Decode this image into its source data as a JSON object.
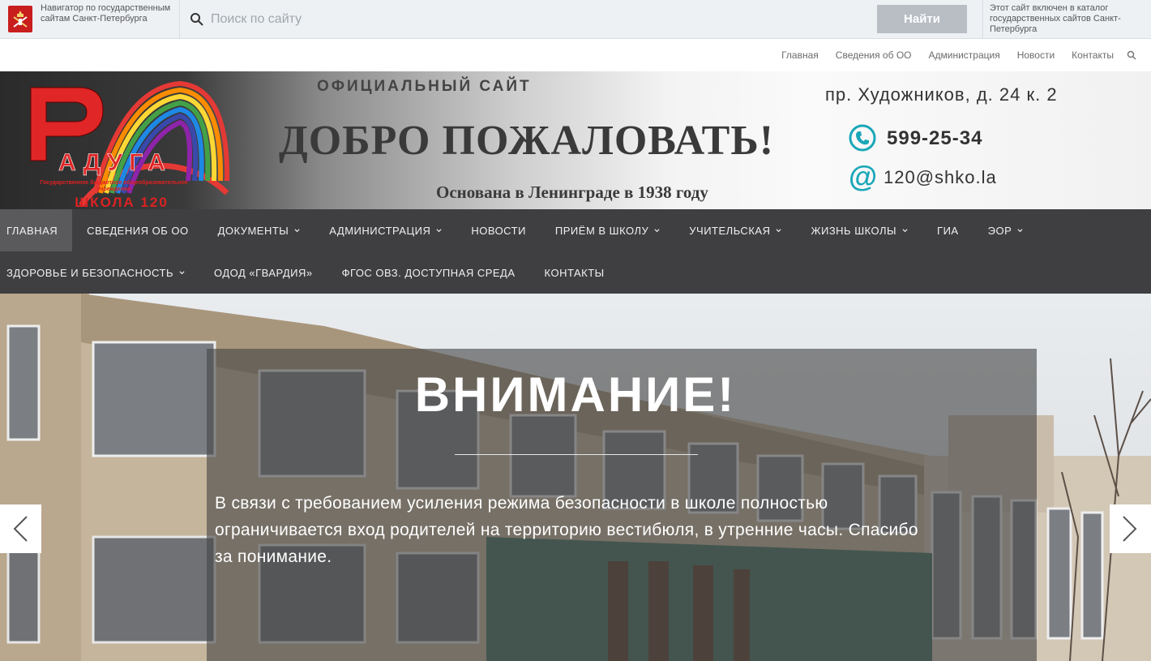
{
  "gov_bar": {
    "navigator_text": "Навигатор по государственным сайтам Санкт-Петербурга",
    "search_placeholder": "Поиск по сайту",
    "search_button": "Найти",
    "catalog_text": "Этот сайт включен в каталог государственных сайтов Санкт-Петербурга",
    "emblem_icon": "spb-emblem-icon",
    "emblem_color": "#c81e1e"
  },
  "sub_nav": {
    "links": [
      "Главная",
      "Сведения об ОО",
      "Администрация",
      "Новости",
      "Контакты"
    ],
    "search_icon": "search-icon"
  },
  "banner": {
    "logo_text": "Радуга",
    "logo_subtitle": "Государственное бюджетное общеобразовательное учреждение",
    "logo_school": "ШКОЛА 120",
    "official": "ОФИЦИАЛЬНЫЙ САЙТ",
    "welcome": "ДОБРО ПОЖАЛОВАТЬ!",
    "founded": "Основана в Ленинграде в 1938 году",
    "address": "пр. Художников, д. 24 к. 2",
    "phone": "599-25-34",
    "email": "120@shko.la"
  },
  "main_menu": {
    "row1": [
      {
        "label": "ГЛАВНАЯ",
        "active": true,
        "dropdown": false
      },
      {
        "label": "СВЕДЕНИЯ ОБ ОО",
        "active": false,
        "dropdown": false
      },
      {
        "label": "ДОКУМЕНТЫ",
        "active": false,
        "dropdown": true
      },
      {
        "label": "АДМИНИСТРАЦИЯ",
        "active": false,
        "dropdown": true
      },
      {
        "label": "НОВОСТИ",
        "active": false,
        "dropdown": false
      },
      {
        "label": "ПРИЁМ В ШКОЛУ",
        "active": false,
        "dropdown": true
      },
      {
        "label": "УЧИТЕЛЬСКАЯ",
        "active": false,
        "dropdown": true
      },
      {
        "label": "ЖИЗНЬ ШКОЛЫ",
        "active": false,
        "dropdown": true
      },
      {
        "label": "ГИА",
        "active": false,
        "dropdown": false
      },
      {
        "label": "ЭОР",
        "active": false,
        "dropdown": true
      }
    ],
    "row2": [
      {
        "label": "ЗДОРОВЬЕ И БЕЗОПАСНОСТЬ",
        "active": false,
        "dropdown": true
      },
      {
        "label": "ОДОД «ГВАРДИЯ»",
        "active": false,
        "dropdown": false
      },
      {
        "label": "ФГОС ОВЗ. ДОСТУПНАЯ СРЕДА",
        "active": false,
        "dropdown": false
      },
      {
        "label": "КОНТАКТЫ",
        "active": false,
        "dropdown": false
      }
    ],
    "bg_color": "#3f3f41",
    "active_color": "#5a5a5c"
  },
  "slider": {
    "title": "ВНИМАНИЕ!",
    "text": "В связи с требованием усиления режима безопасности в школе полностью ограничивается вход родителей на территорию вестибюля, в утренние часы. Спасибо за понимание.",
    "prev_icon": "chevron-left-icon",
    "next_icon": "chevron-right-icon"
  }
}
